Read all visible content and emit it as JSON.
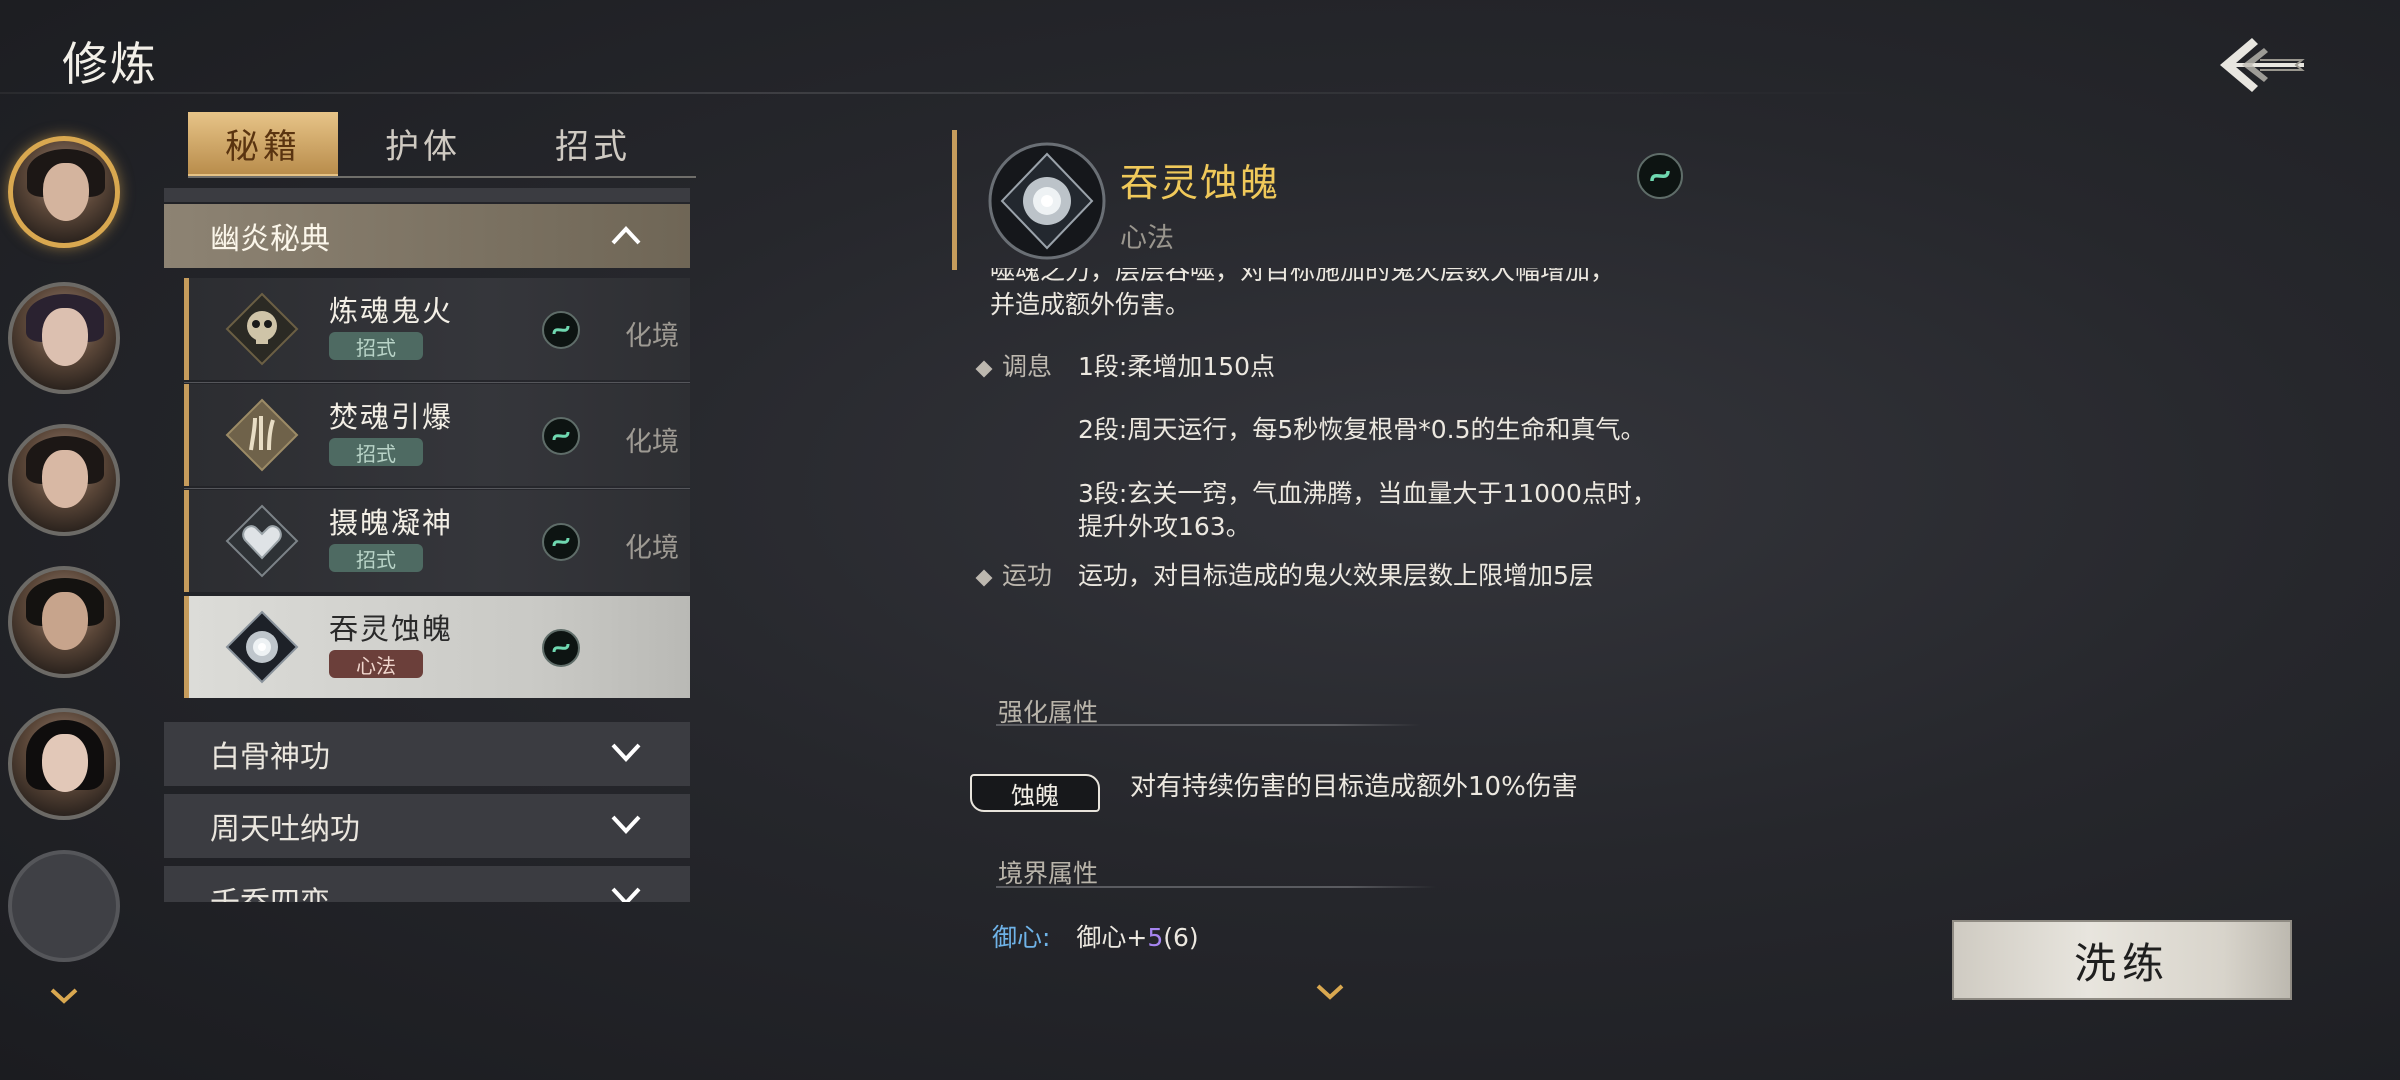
{
  "header": {
    "title": "修炼"
  },
  "tabs": [
    {
      "label": "秘籍",
      "active": true
    },
    {
      "label": "护体",
      "active": false
    },
    {
      "label": "招式",
      "active": false
    }
  ],
  "groups": {
    "open": {
      "label": "幽炎秘典"
    },
    "closed": [
      {
        "label": "白骨神功"
      },
      {
        "label": "周天吐纳功"
      },
      {
        "label": "千乔四变"
      }
    ]
  },
  "skills": [
    {
      "name": "炼魂鬼火",
      "tag": "招式",
      "state": "化境",
      "selected": false
    },
    {
      "name": "焚魂引爆",
      "tag": "招式",
      "state": "化境",
      "selected": false
    },
    {
      "name": "摄魄凝神",
      "tag": "招式",
      "state": "化境",
      "selected": false
    },
    {
      "name": "吞灵蚀魄",
      "tag": "心法",
      "state": "",
      "selected": true
    }
  ],
  "detail": {
    "name": "吞灵蚀魄",
    "type": "心法",
    "desc_line1": "噬魂之力，层层吞噬，对目标施加的鬼火层数大幅增加，",
    "desc_line2": "并造成额外伤害。",
    "tiaoxi_label": "调息",
    "tiaoxi_1": "1段:柔增加150点",
    "tiaoxi_2": "2段:周天运行，每5秒恢复根骨*0.5的生命和真气。",
    "tiaoxi_3a": "3段:玄关一窍，气血沸腾，当血量大于11000点时，",
    "tiaoxi_3b": "提升外攻163。",
    "yungong_label": "运功",
    "yungong_text": "运功，对目标造成的鬼火效果层数上限增加5层",
    "enhance_header": "强化属性",
    "enhance_badge": "蚀魄",
    "enhance_text": "对有持续伤害的目标造成额外10%伤害",
    "realm_header": "境界属性",
    "realm_key": "御心",
    "realm_colon": ":",
    "realm_value_prefix": "御心+",
    "realm_value_bonus": "5",
    "realm_value_suffix": "(6)"
  },
  "actions": {
    "wash": "洗练"
  },
  "colors": {
    "accent_gold": "#c69c5c",
    "skill_name_gold": "#f0c95a",
    "realm_blue": "#6fb3e8",
    "bonus_purple": "#a685f0"
  }
}
